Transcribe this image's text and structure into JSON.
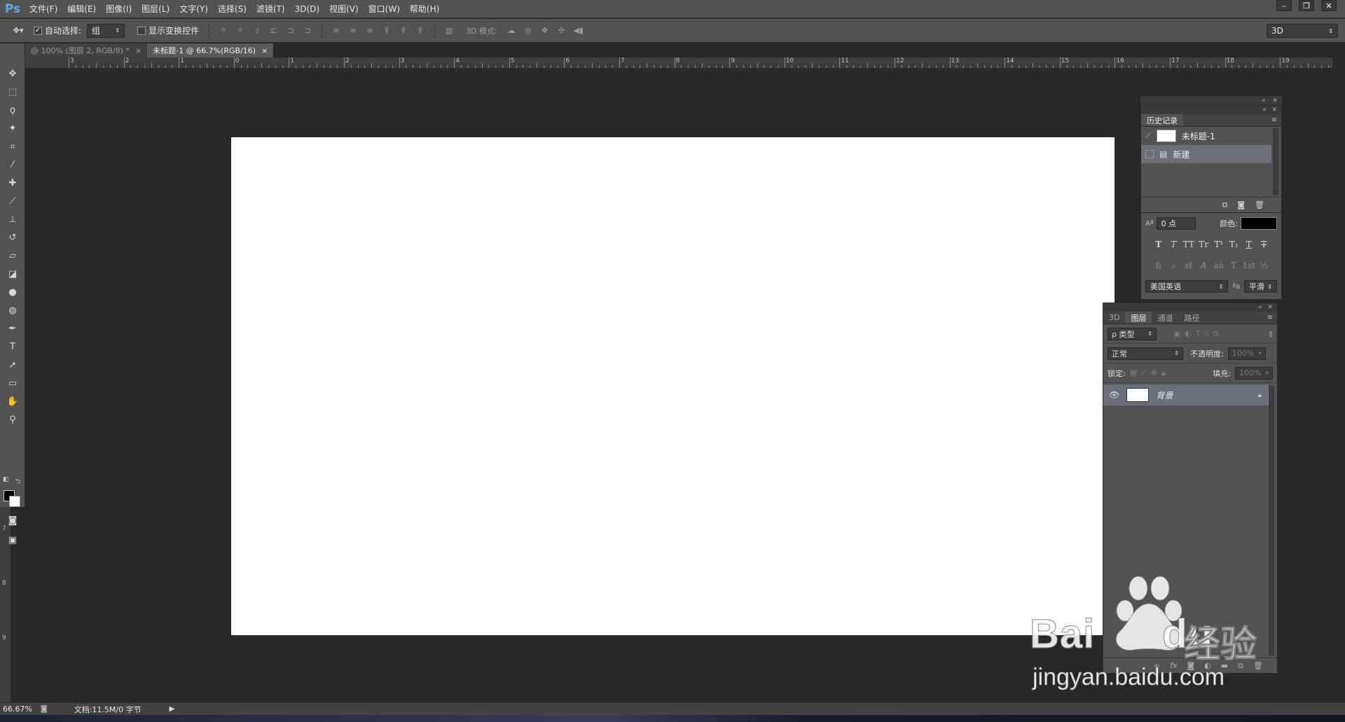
{
  "app": {
    "logo": "Ps"
  },
  "menu": [
    "文件(F)",
    "编辑(E)",
    "图像(I)",
    "图层(L)",
    "文字(Y)",
    "选择(S)",
    "滤镜(T)",
    "3D(D)",
    "视图(V)",
    "窗口(W)",
    "帮助(H)"
  ],
  "window_controls": {
    "minimize": "–",
    "restore": "❐",
    "close": "✕"
  },
  "options": {
    "auto_select_label": "自动选择:",
    "auto_select_checked": true,
    "auto_select_value": "组",
    "show_transform_label": "显示变换控件",
    "show_transform_checked": false,
    "mode_3d_label": "3D 模式:",
    "workspace_value": "3D"
  },
  "tabs": [
    {
      "label": "@ 100% (图层 2, RGB/8) *",
      "close": "×",
      "active": false
    },
    {
      "label": "未标题-1 @ 66.7%(RGB/16)",
      "close": "×",
      "active": true
    }
  ],
  "ruler_top_labels": [
    "3",
    "2",
    "1",
    "0",
    "1",
    "2",
    "3",
    "4",
    "5",
    "6",
    "7",
    "8",
    "9",
    "10",
    "11",
    "12",
    "13",
    "14",
    "15",
    "16",
    "17",
    "18",
    "19"
  ],
  "ruler_left_labels": [
    "7",
    "8",
    "9"
  ],
  "tools": [
    {
      "name": "move-tool-icon",
      "glyph": "✥"
    },
    {
      "name": "marquee-tool-icon",
      "glyph": "⬚"
    },
    {
      "name": "lasso-tool-icon",
      "glyph": "ϙ"
    },
    {
      "name": "magic-wand-tool-icon",
      "glyph": "✦"
    },
    {
      "name": "crop-tool-icon",
      "glyph": "⌗"
    },
    {
      "name": "eyedropper-tool-icon",
      "glyph": "⁄"
    },
    {
      "name": "healing-brush-tool-icon",
      "glyph": "✚"
    },
    {
      "name": "brush-tool-icon",
      "glyph": "⟋"
    },
    {
      "name": "stamp-tool-icon",
      "glyph": "⊥"
    },
    {
      "name": "history-brush-tool-icon",
      "glyph": "↺"
    },
    {
      "name": "eraser-tool-icon",
      "glyph": "▱"
    },
    {
      "name": "paint-bucket-tool-icon",
      "glyph": "◪"
    },
    {
      "name": "blur-tool-icon",
      "glyph": "●"
    },
    {
      "name": "dodge-tool-icon",
      "glyph": "◍"
    },
    {
      "name": "pen-tool-icon",
      "glyph": "✒"
    },
    {
      "name": "type-tool-icon",
      "glyph": "T"
    },
    {
      "name": "path-selection-tool-icon",
      "glyph": "➚"
    },
    {
      "name": "rectangle-tool-icon",
      "glyph": "▭"
    },
    {
      "name": "hand-tool-icon",
      "glyph": "✋"
    },
    {
      "name": "zoom-tool-icon",
      "glyph": "⚲"
    }
  ],
  "colors": {
    "foreground": "#000000",
    "background": "#ffffff",
    "selection": "#6a6f7a",
    "canvas": "#ffffff"
  },
  "history": {
    "tab": "历史记录",
    "snapshot_label": "未标题-1",
    "items": [
      {
        "label": "新建",
        "selected": true
      }
    ],
    "footer_icons": [
      "new-document-from-state-icon",
      "camera-icon",
      "trash-icon"
    ]
  },
  "character": {
    "size_value": "0 点",
    "color_label": "颜色:",
    "glyph_row1": [
      "T",
      "T",
      "TT",
      "Tr",
      "T¹",
      "T₁",
      "T",
      "T"
    ],
    "glyph_row2": [
      "ﬁ",
      "ℴ",
      "st",
      "A",
      "aā",
      "T",
      "1st",
      "½"
    ],
    "language": "美国英语",
    "aa_label": "ªa",
    "antialias": "平滑"
  },
  "layers": {
    "tabs": [
      "3D",
      "图层",
      "通道",
      "路径"
    ],
    "active_tab": 1,
    "filter_kind": "ρ 类型",
    "blend_mode": "正常",
    "opacity_label": "不透明度:",
    "opacity_value": "100%",
    "lock_label": "锁定:",
    "fill_label": "填充:",
    "fill_value": "100%",
    "items": [
      {
        "name": "背景",
        "visible": true,
        "locked": true
      }
    ]
  },
  "status": {
    "zoom": "66.67%",
    "doc_info": "文档:11.5M/0 字节"
  },
  "watermark": {
    "brand": "Baidu",
    "brand_b": "Bai",
    "brand_du": "du",
    "cn": "经验",
    "url": "jingyan.baidu.com"
  }
}
